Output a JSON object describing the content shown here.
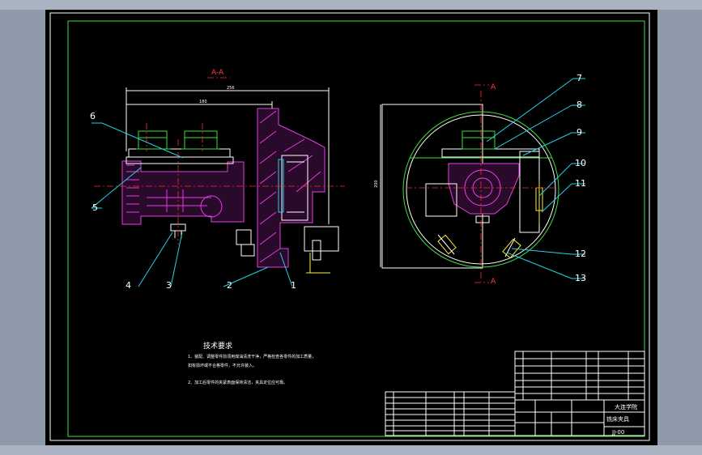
{
  "section_label": "A-A",
  "section_marks": [
    "A",
    "A"
  ],
  "part_numbers": [
    "1",
    "2",
    "3",
    "4",
    "5",
    "6",
    "7",
    "8",
    "9",
    "10",
    "11",
    "12",
    "13"
  ],
  "tech_req": {
    "title": "技术要求",
    "line1": "1、装配、调整零件前须用煤油清洗干净，严格检查各零件的加工质量，",
    "line2": "如有损坏或不合格零件，不允许装入。",
    "line3": "2、加工后零件的夹紧表面保持清洁，夹具定位应可靠。"
  },
  "title_block": {
    "school": "大连学院",
    "drawing_name": "铣床夹具",
    "code": "JJ-00"
  },
  "colors": {
    "frame": "#3fdc3f",
    "outline": "#ffffff",
    "section": "#e23fe0",
    "leader": "#22d3e6",
    "center": "#ff2b2b"
  }
}
